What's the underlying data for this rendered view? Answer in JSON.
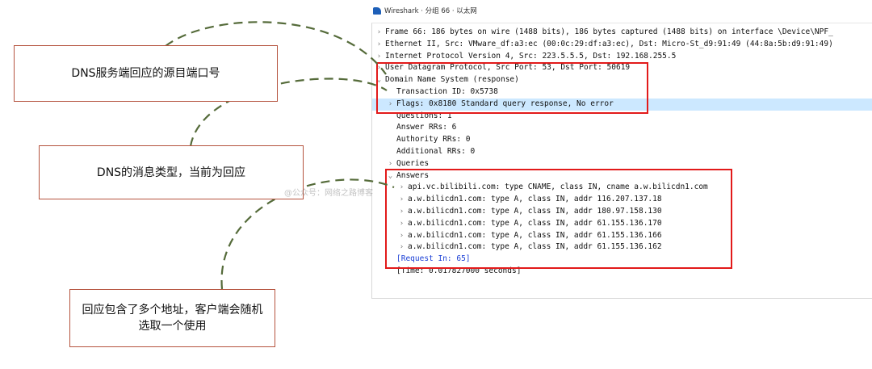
{
  "window": {
    "title": "Wireshark · 分组 66 · 以太网"
  },
  "packet_tree": [
    {
      "indent": 0,
      "expander": "collapsed",
      "text": "Frame 66: 186 bytes on wire (1488 bits), 186 bytes captured (1488 bits) on interface \\Device\\NPF_",
      "selected": false
    },
    {
      "indent": 0,
      "expander": "collapsed",
      "text": "Ethernet II, Src: VMware_df:a3:ec (00:0c:29:df:a3:ec), Dst: Micro-St_d9:91:49 (44:8a:5b:d9:91:49)",
      "selected": false
    },
    {
      "indent": 0,
      "expander": "collapsed",
      "text": "Internet Protocol Version 4, Src: 223.5.5.5, Dst: 192.168.255.5",
      "selected": false
    },
    {
      "indent": 0,
      "expander": "collapsed",
      "text": "User Datagram Protocol, Src Port: 53, Dst Port: 50619",
      "selected": false
    },
    {
      "indent": 0,
      "expander": "expanded",
      "text": "Domain Name System (response)",
      "selected": false
    },
    {
      "indent": 1,
      "expander": "none",
      "text": "Transaction ID: 0x5738",
      "selected": false
    },
    {
      "indent": 1,
      "expander": "collapsed",
      "text": "Flags: 0x8180 Standard query response, No error",
      "selected": true
    },
    {
      "indent": 1,
      "expander": "none",
      "text": "Questions: 1",
      "selected": false
    },
    {
      "indent": 1,
      "expander": "none",
      "text": "Answer RRs: 6",
      "selected": false
    },
    {
      "indent": 1,
      "expander": "none",
      "text": "Authority RRs: 0",
      "selected": false
    },
    {
      "indent": 1,
      "expander": "none",
      "text": "Additional RRs: 0",
      "selected": false
    },
    {
      "indent": 1,
      "expander": "collapsed",
      "text": "Queries",
      "selected": false
    },
    {
      "indent": 1,
      "expander": "expanded",
      "text": "Answers",
      "selected": false
    },
    {
      "indent": 2,
      "expander": "collapsed",
      "text": "api.vc.bilibili.com: type CNAME, class IN, cname a.w.bilicdn1.com",
      "selected": false
    },
    {
      "indent": 2,
      "expander": "collapsed",
      "text": "a.w.bilicdn1.com: type A, class IN, addr 116.207.137.18",
      "selected": false
    },
    {
      "indent": 2,
      "expander": "collapsed",
      "text": "a.w.bilicdn1.com: type A, class IN, addr 180.97.158.130",
      "selected": false
    },
    {
      "indent": 2,
      "expander": "collapsed",
      "text": "a.w.bilicdn1.com: type A, class IN, addr 61.155.136.170",
      "selected": false
    },
    {
      "indent": 2,
      "expander": "collapsed",
      "text": "a.w.bilicdn1.com: type A, class IN, addr 61.155.136.166",
      "selected": false
    },
    {
      "indent": 2,
      "expander": "collapsed",
      "text": "a.w.bilicdn1.com: type A, class IN, addr 61.155.136.162",
      "selected": false
    },
    {
      "indent": 1,
      "expander": "none",
      "text": "[Request In: 65]",
      "selected": false,
      "link": true
    },
    {
      "indent": 1,
      "expander": "none",
      "text": "[Time: 0.017827000 seconds]",
      "selected": false
    }
  ],
  "annotations": {
    "ports": "DNS服务端回应的源目端口号",
    "message_type": "DNS的消息类型，当前为回应",
    "multi_address": "回应包含了多个地址，客户端会随机选取一个使用"
  },
  "watermark": "@公众号：网络之路博客",
  "colors": {
    "highlight": "#e21a1a",
    "selected_row": "#cce8ff",
    "connector": "#556b3a",
    "link": "#1a3fd6"
  }
}
